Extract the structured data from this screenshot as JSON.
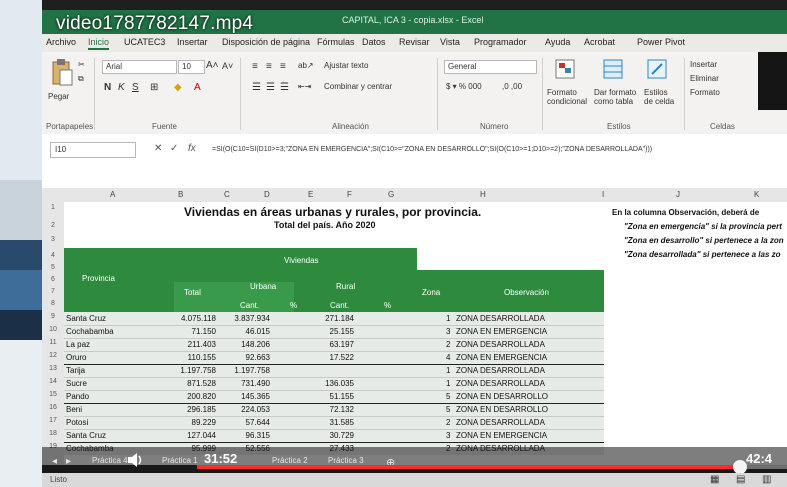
{
  "window": {
    "video_label": "video1787782147.mp4",
    "doc_title": "CAPITAL, ICA 3 - copia.xlsx - Excel"
  },
  "ribbon_tabs": [
    "Archivo",
    "Inicio",
    "UCATEC3",
    "Insertar",
    "Disposición de página",
    "Fórmulas",
    "Datos",
    "Revisar",
    "Vista",
    "Programador",
    "Ayuda",
    "Acrobat",
    "Power Pivot"
  ],
  "ribbon": {
    "paste": "Pegar",
    "font_name": "Arial",
    "font_size": "10",
    "wrap": "Ajustar texto",
    "merge": "Combinar y centrar",
    "number_format": "General",
    "cond_format": "Formato condicional",
    "table_format": "Dar formato como tabla",
    "cell_styles": "Estilos de celda",
    "insert": "Insertar",
    "delete": "Eliminar",
    "format": "Formato",
    "groups": [
      "Portapapeles",
      "Fuente",
      "Alineación",
      "Número",
      "Estilos",
      "Celdas"
    ]
  },
  "formula_bar": {
    "name_box": "I10",
    "fx": "fx",
    "text": "=SI(O(C10=SI(D10>=3;\"ZONA EN EMERGENCIA\";SI(C10>=\"ZONA EN DESARROLLO\";SI(O(C10>=1;D10>=2);\"ZONA DESARROLLADA\")))"
  },
  "columns": [
    "A",
    "B",
    "C",
    "D",
    "E",
    "F",
    "G",
    "H",
    "I",
    "J",
    "K"
  ],
  "rows": [
    "1",
    "2",
    "3",
    "4",
    "5",
    "6",
    "7",
    "8",
    "9",
    "10",
    "11",
    "12",
    "13",
    "14",
    "15",
    "16",
    "17",
    "18",
    "19"
  ],
  "sheet": {
    "title": "Viviendas en áreas urbanas y rurales, por provincia.",
    "subtitle": "Total del país. Año 2020",
    "headers": {
      "viviendas": "Viviendas",
      "provincia": "Provincia",
      "total": "Total",
      "urbana": "Urbana",
      "rural": "Rural",
      "zona": "Zona",
      "observacion": "Observación",
      "cant": "Cant.",
      "pct": "%"
    },
    "notes": [
      "En la columna Observación, deberá de",
      "\"Zona en emergencia\" si la provincia pert",
      "\"Zona en desarrollo\" si pertenece a la zon",
      "\"Zona desarrollada\" si pertenece a las zo"
    ],
    "data_rows": [
      {
        "provincia": "Santa Cruz",
        "total": "4.075.118",
        "urbana": "3.837.934",
        "rural": "271.184",
        "zona": "1",
        "obs": "ZONA DESARROLLADA"
      },
      {
        "provincia": "Cochabamba",
        "total": "71.150",
        "urbana": "46.015",
        "rural": "25.155",
        "zona": "3",
        "obs": "ZONA EN EMERGENCIA"
      },
      {
        "provincia": "La paz",
        "total": "211.403",
        "urbana": "148.206",
        "rural": "63.197",
        "zona": "2",
        "obs": "ZONA DESARROLLADA"
      },
      {
        "provincia": "Oruro",
        "total": "110.155",
        "urbana": "92.663",
        "rural": "17.522",
        "zona": "4",
        "obs": "ZONA EN EMERGENCIA"
      },
      {
        "provincia": "Tarija",
        "total": "1.197.758",
        "urbana": "1.197.758",
        "rural": "",
        "zona": "1",
        "obs": "ZONA DESARROLLADA"
      },
      {
        "provincia": "Sucre",
        "total": "871.528",
        "urbana": "731.490",
        "rural": "136.035",
        "zona": "1",
        "obs": "ZONA DESARROLLADA"
      },
      {
        "provincia": "Pando",
        "total": "200.820",
        "urbana": "145.365",
        "rural": "51.155",
        "zona": "5",
        "obs": "ZONA EN DESARROLLO"
      },
      {
        "provincia": "Beni",
        "total": "296.185",
        "urbana": "224.053",
        "rural": "72.132",
        "zona": "5",
        "obs": "ZONA EN DESARROLLO"
      },
      {
        "provincia": "Potosi",
        "total": "89.229",
        "urbana": "57.644",
        "rural": "31.585",
        "zona": "2",
        "obs": "ZONA DESARROLLADA"
      },
      {
        "provincia": "Santa Cruz",
        "total": "127.044",
        "urbana": "96.315",
        "rural": "30.729",
        "zona": "3",
        "obs": "ZONA EN EMERGENCIA"
      },
      {
        "provincia": "Cochabamba",
        "total": "95.999",
        "urbana": "52.556",
        "rural": "27.433",
        "zona": "2",
        "obs": "ZONA DESARROLLADA"
      }
    ]
  },
  "sheet_tabs": [
    "Práctica 4",
    "Práctica 1",
    "Práctica 2",
    "Práctica 3"
  ],
  "video": {
    "current_time": "31:52",
    "end_time": "42:4",
    "progress": 0.92
  },
  "status": {
    "mode": "Listo"
  }
}
